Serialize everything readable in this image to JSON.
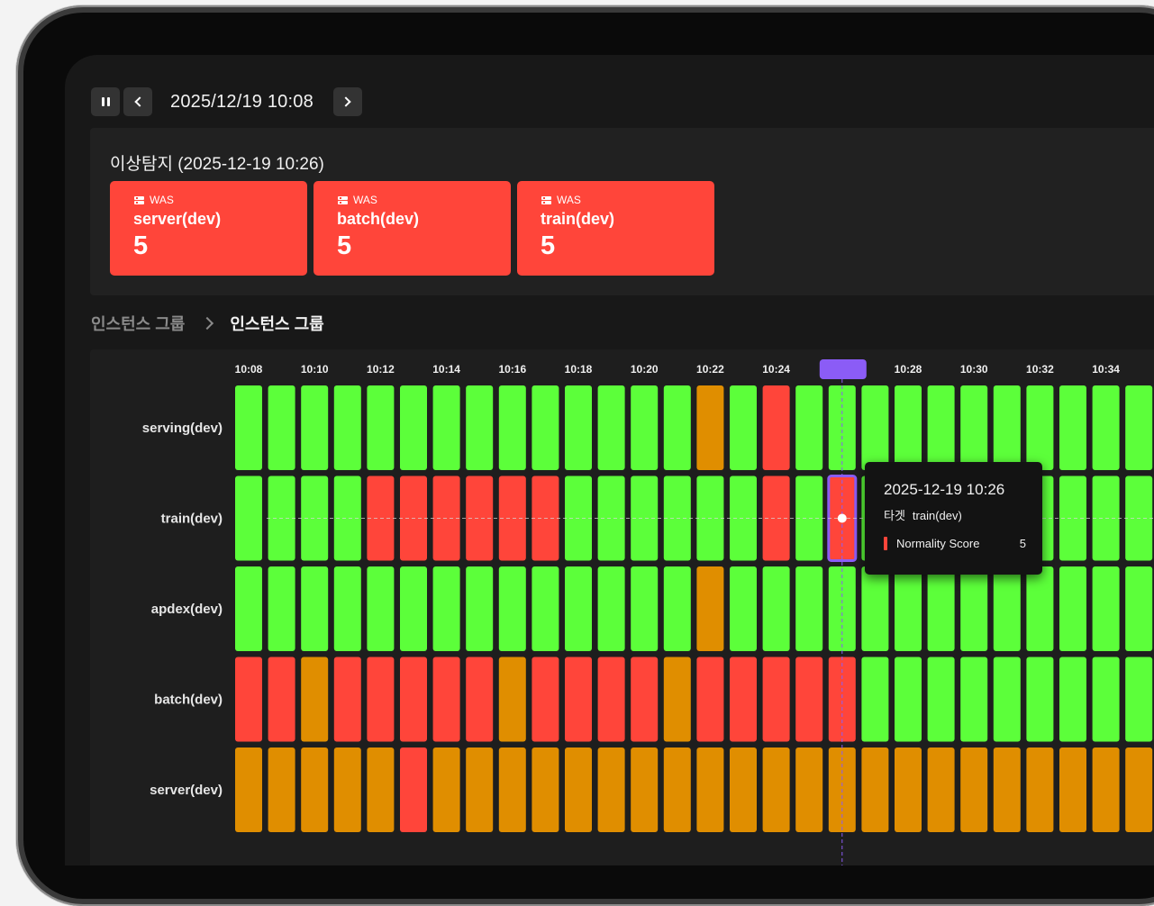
{
  "toolbar": {
    "pause_icon": "pause-icon",
    "prev_icon": "chevron-left-icon",
    "next_icon": "chevron-right-icon",
    "date": "2025/12/19 10:08"
  },
  "anomaly": {
    "title": "이상탐지 (2025-12-19 10:26)",
    "cards": [
      {
        "type": "WAS",
        "name": "server(dev)",
        "value": "5"
      },
      {
        "type": "WAS",
        "name": "batch(dev)",
        "value": "5"
      },
      {
        "type": "WAS",
        "name": "train(dev)",
        "value": "5"
      }
    ],
    "card_color": "#ff453a"
  },
  "breadcrumb": {
    "parent": "인스턴스 그룹",
    "current": "인스턴스 그룹"
  },
  "heatmap": {
    "columns_per_label": 2,
    "time_labels": [
      "10:08",
      "10:10",
      "10:12",
      "10:14",
      "10:16",
      "10:18",
      "10:20",
      "10:22",
      "10:24",
      "10:26",
      "10:28",
      "10:30",
      "10:32",
      "10:34"
    ],
    "selected_column": 18,
    "rows": [
      "serving(dev)",
      "train(dev)",
      "apdex(dev)",
      "batch(dev)",
      "server(dev)"
    ],
    "colors": {
      "G": "#5cff3a",
      "O": "#e08e00",
      "R": "#ff453a",
      "selected": "#8b5cf6"
    },
    "cells": [
      [
        "G",
        "G",
        "G",
        "G",
        "G",
        "G",
        "G",
        "G",
        "G",
        "G",
        "G",
        "G",
        "G",
        "G",
        "O",
        "G",
        "R",
        "G",
        "G",
        "G",
        "G",
        "G",
        "G",
        "G",
        "G",
        "G",
        "G",
        "G"
      ],
      [
        "G",
        "G",
        "G",
        "G",
        "R",
        "R",
        "R",
        "R",
        "R",
        "R",
        "G",
        "G",
        "G",
        "G",
        "G",
        "G",
        "R",
        "G",
        "R",
        "G",
        "G",
        "G",
        "G",
        "G",
        "G",
        "G",
        "G",
        "G"
      ],
      [
        "G",
        "G",
        "G",
        "G",
        "G",
        "G",
        "G",
        "G",
        "G",
        "G",
        "G",
        "G",
        "G",
        "G",
        "O",
        "G",
        "G",
        "G",
        "G",
        "G",
        "G",
        "G",
        "G",
        "G",
        "G",
        "G",
        "G",
        "G"
      ],
      [
        "R",
        "R",
        "O",
        "R",
        "R",
        "R",
        "R",
        "R",
        "O",
        "R",
        "R",
        "R",
        "R",
        "O",
        "R",
        "R",
        "R",
        "R",
        "R",
        "G",
        "G",
        "G",
        "G",
        "G",
        "G",
        "G",
        "G",
        "G"
      ],
      [
        "O",
        "O",
        "O",
        "O",
        "O",
        "R",
        "O",
        "O",
        "O",
        "O",
        "O",
        "O",
        "O",
        "O",
        "O",
        "O",
        "O",
        "O",
        "O",
        "O",
        "O",
        "O",
        "O",
        "O",
        "O",
        "O",
        "O",
        "O"
      ]
    ]
  },
  "tooltip": {
    "time": "2025-12-19  10:26",
    "target_label": "타겟",
    "target_value": "train(dev)",
    "metric_label": "Normality Score",
    "metric_value": "5"
  }
}
